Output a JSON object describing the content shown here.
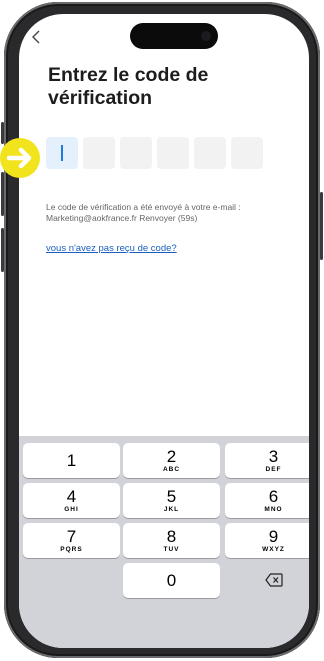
{
  "screen": {
    "title": "Entrez le code de vérification",
    "code_length": 6,
    "info_text": "Le code de vérification a été envoyé à votre e-mail : Marketing@aokfrance.fr  Renvoyer (59s)",
    "resend_link": "vous n'avez pas reçu de code?"
  },
  "keypad": {
    "keys": [
      {
        "num": "1",
        "letters": ""
      },
      {
        "num": "2",
        "letters": "ABC"
      },
      {
        "num": "3",
        "letters": "DEF"
      },
      {
        "num": "4",
        "letters": "GHI"
      },
      {
        "num": "5",
        "letters": "JKL"
      },
      {
        "num": "6",
        "letters": "MNO"
      },
      {
        "num": "7",
        "letters": "PQRS"
      },
      {
        "num": "8",
        "letters": "TUV"
      },
      {
        "num": "9",
        "letters": "WXYZ"
      },
      {
        "num": "0",
        "letters": ""
      }
    ],
    "delete_icon": "backspace-icon"
  },
  "overlay": {
    "icon": "arrow-right-icon",
    "color": "#f2e41c"
  },
  "colors": {
    "accent": "#1e7ae0",
    "link": "#1a5fbf",
    "keypad_bg": "#d1d3d9"
  }
}
